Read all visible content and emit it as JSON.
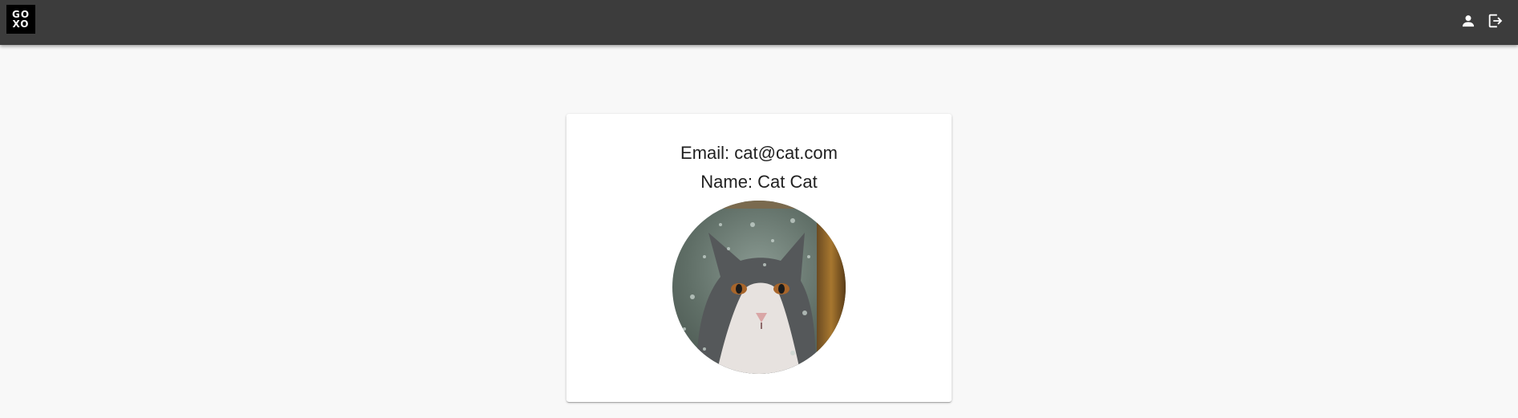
{
  "header": {
    "logo_line1": "GO",
    "logo_line2": "XO",
    "profile_icon": "person-icon",
    "logout_icon": "logout-icon"
  },
  "profile": {
    "email_label": "Email: cat@cat.com",
    "name_label": "Name: Cat Cat",
    "avatar_alt": "cat avatar"
  },
  "colors": {
    "header_bg": "#3c3c3c",
    "page_bg": "#f8f8f8",
    "card_bg": "#ffffff"
  }
}
